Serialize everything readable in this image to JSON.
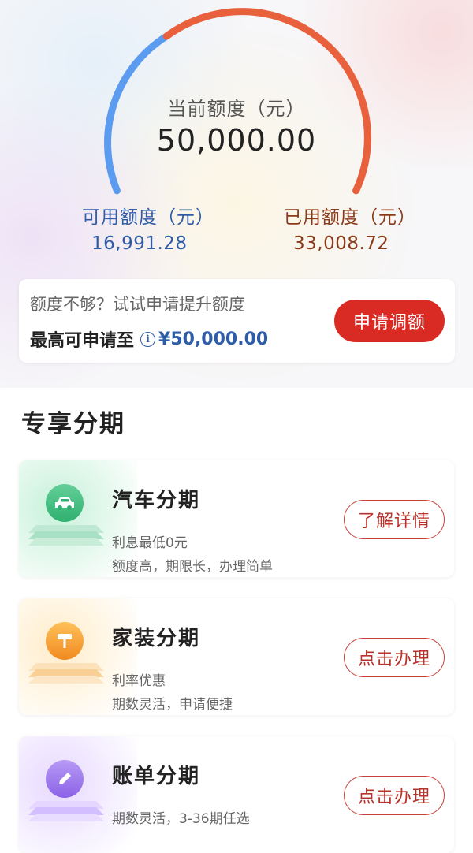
{
  "quota": {
    "title": "当前额度（元）",
    "amount": "50,000.00",
    "available_label": "可用额度（元）",
    "available_value": "16,991.28",
    "used_label": "已用额度（元）",
    "used_value": "33,008.72",
    "used_fraction": 0.66,
    "colors": {
      "available": "#5b9bf0",
      "used": "#e8603c"
    }
  },
  "promo": {
    "hint": "额度不够？试试申请提升额度",
    "max_label": "最高可申请至",
    "max_amount": "¥50,000.00",
    "button": "申请调额"
  },
  "section": {
    "title": "专享分期"
  },
  "cards": [
    {
      "title": "汽车分期",
      "line1": "利息最低0元",
      "line2": "额度高，期限长，办理简单",
      "button": "了解详情",
      "icon": "car-icon"
    },
    {
      "title": "家装分期",
      "line1": "利率优惠",
      "line2": "期数灵活，申请便捷",
      "button": "点击办理",
      "icon": "paint-roller-icon"
    },
    {
      "title": "账单分期",
      "line1": "期数灵活，3-36期任选",
      "line2": "",
      "button": "点击办理",
      "icon": "pencil-icon"
    }
  ],
  "accent": "#d92b24"
}
